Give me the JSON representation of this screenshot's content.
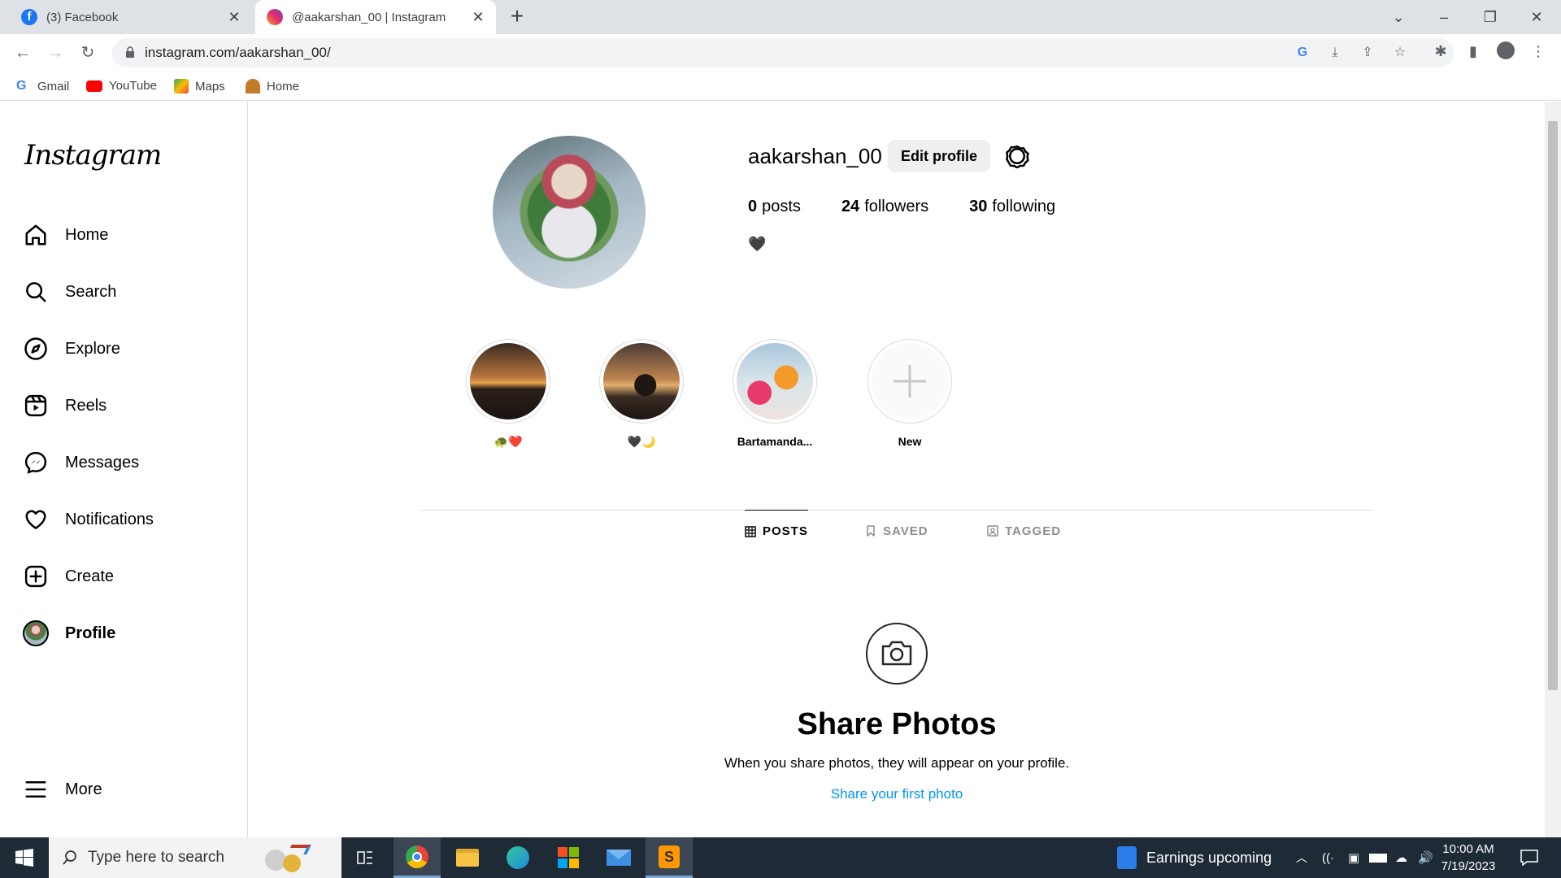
{
  "browser": {
    "tabs": [
      {
        "title": "(3) Facebook",
        "active": false
      },
      {
        "title": "@aakarshan_00 | Instagram",
        "active": true
      }
    ],
    "url": "instagram.com/aakarshan_00/",
    "bookmarks": [
      "Gmail",
      "YouTube",
      "Maps",
      "Home"
    ]
  },
  "sidebar": {
    "logo": "Instagram",
    "items": [
      {
        "label": "Home",
        "icon": "home-icon"
      },
      {
        "label": "Search",
        "icon": "search-icon"
      },
      {
        "label": "Explore",
        "icon": "compass-icon"
      },
      {
        "label": "Reels",
        "icon": "reels-icon"
      },
      {
        "label": "Messages",
        "icon": "messenger-icon"
      },
      {
        "label": "Notifications",
        "icon": "heart-icon"
      },
      {
        "label": "Create",
        "icon": "plus-square-icon"
      },
      {
        "label": "Profile",
        "icon": "avatar"
      }
    ],
    "more": "More"
  },
  "profile": {
    "username": "aakarshan_00",
    "edit_label": "Edit profile",
    "posts_count": "0",
    "posts_label": "posts",
    "followers_count": "24",
    "followers_label": "followers",
    "following_count": "30",
    "following_label": "following",
    "bio": "🖤"
  },
  "highlights": [
    {
      "label": "🐢❤️"
    },
    {
      "label": "🖤🌙"
    },
    {
      "label": "Bartamanda..."
    },
    {
      "label": "New"
    }
  ],
  "profile_tabs": [
    {
      "label": "POSTS",
      "active": true
    },
    {
      "label": "SAVED",
      "active": false
    },
    {
      "label": "TAGGED",
      "active": false
    }
  ],
  "empty_state": {
    "title": "Share Photos",
    "text": "When you share photos, they will appear on your profile.",
    "link": "Share your first photo"
  },
  "taskbar": {
    "search_placeholder": "Type here to search",
    "news": "Earnings upcoming",
    "time": "10:00 AM",
    "date": "7/19/2023"
  },
  "colors": {
    "link": "#0095f6",
    "border": "#dbdbdb",
    "taskbar": "#1f2a37"
  }
}
